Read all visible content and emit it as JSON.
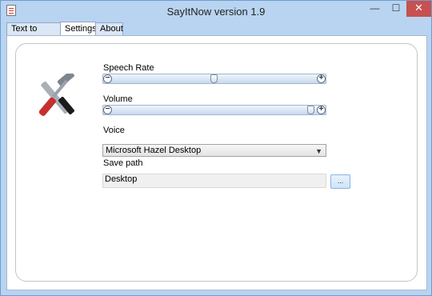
{
  "window": {
    "title": "SayItNow version 1.9",
    "minimize_glyph": "—",
    "maximize_glyph": "☐",
    "close_glyph": "✕"
  },
  "tabs": [
    {
      "label": "Text to speech",
      "active": false
    },
    {
      "label": "Settings",
      "active": true
    },
    {
      "label": "About",
      "active": false
    }
  ],
  "settings": {
    "speech_rate": {
      "label": "Speech Rate",
      "value_fraction": 0.5
    },
    "volume": {
      "label": "Volume",
      "value_fraction": 1.0
    },
    "voice": {
      "label": "Voice",
      "selected": "Microsoft Hazel Desktop"
    },
    "save_path": {
      "label": "Save path",
      "value": "Desktop",
      "browse_label": "..."
    }
  },
  "icons": {
    "app": "speech-app-icon",
    "settings": "hammer-screwdriver-icon",
    "minus": "minus-icon",
    "plus": "plus-icon",
    "dropdown": "chevron-down-icon"
  },
  "colors": {
    "titlebar": "#b8d4f0",
    "close_button": "#c75050"
  }
}
